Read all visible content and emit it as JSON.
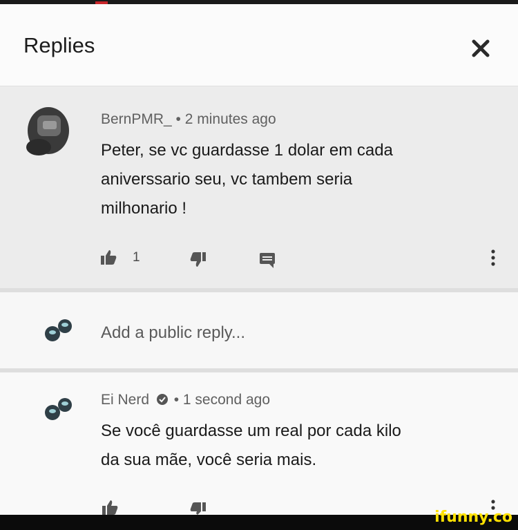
{
  "header": {
    "title": "Replies",
    "close_icon": "close-icon"
  },
  "comment": {
    "author": "BernPMR_",
    "time": "• 2 minutes ago",
    "lines": [
      "Peter, se vc guardasse 1 dolar em cada",
      "aniverssario seu, vc tambem seria",
      "milhonario !"
    ],
    "like_count": "1",
    "icons": [
      "thumbs-up-icon",
      "thumbs-down-icon",
      "reply-icon",
      "more-icon"
    ]
  },
  "reply_box": {
    "placeholder": "Add a public reply..."
  },
  "reply": {
    "author": "Ei Nerd",
    "time": "• 1 second ago",
    "verified_icon": "verified-check-icon",
    "lines": [
      "Se você guardasse um real por cada kilo",
      "da sua mãe, você seria mais."
    ]
  },
  "footer": {
    "brand": "ifunny.co"
  },
  "colors": {
    "header_bg": "#fbfbfb",
    "comment_bg": "#ececec",
    "footer_bg": "#0b0b0b",
    "brand": "#ffe100",
    "accent_red": "#c8262a"
  }
}
